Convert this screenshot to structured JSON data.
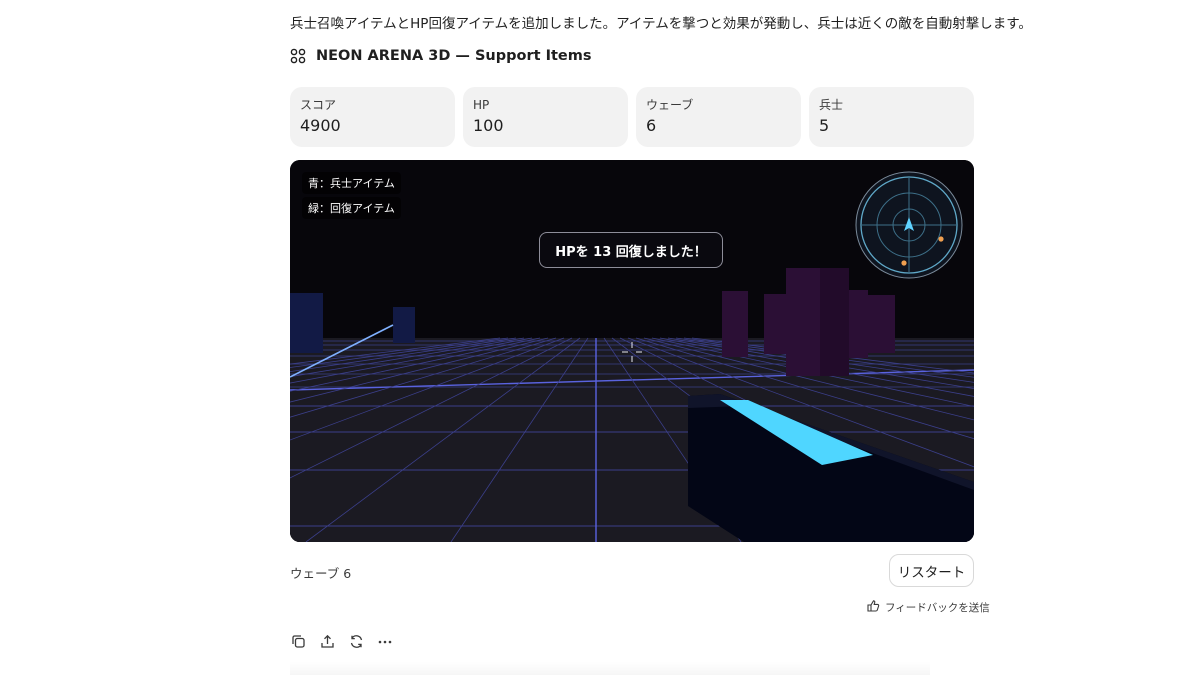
{
  "intro": "兵士召喚アイテムとHP回復アイテムを追加しました。アイテムを撃つと効果が発動し、兵士は近くの敵を自動射撃します。",
  "widget": {
    "icon": "widget-grid-icon",
    "title": "NEON ARENA 3D — Support Items"
  },
  "stats": [
    {
      "label": "スコア",
      "value": "4900"
    },
    {
      "label": "HP",
      "value": "100"
    },
    {
      "label": "ウェーブ",
      "value": "6"
    },
    {
      "label": "兵士",
      "value": "5"
    }
  ],
  "game": {
    "legend_blue": "青：兵士アイテム",
    "legend_green": "緑：回復アイテム",
    "toast": "HPを 13 回復しました！",
    "radar": {
      "icon": "radar-icon",
      "player_color": "#5fd3ff",
      "blip_color": "#f0a050"
    },
    "crosshair_icon": "crosshair-icon",
    "colors": {
      "sky": "#07060b",
      "floor": "#1b1a22",
      "grid": "#3b3f8a",
      "grid_bright": "#5a63e0",
      "pillar_purple": "#2b0f35",
      "pillar_navy": "#121a45",
      "gun_body": "#030616",
      "gun_stripe": "#4fd6ff"
    }
  },
  "footer": {
    "wave_text": "ウェーブ 6",
    "restart_label": "リスタート",
    "feedback_label": "フィードバックを送信",
    "feedback_icon": "feedback-icon"
  },
  "actions": [
    {
      "icon": "copy-icon"
    },
    {
      "icon": "share-icon"
    },
    {
      "icon": "regenerate-icon"
    },
    {
      "icon": "more-icon"
    }
  ]
}
